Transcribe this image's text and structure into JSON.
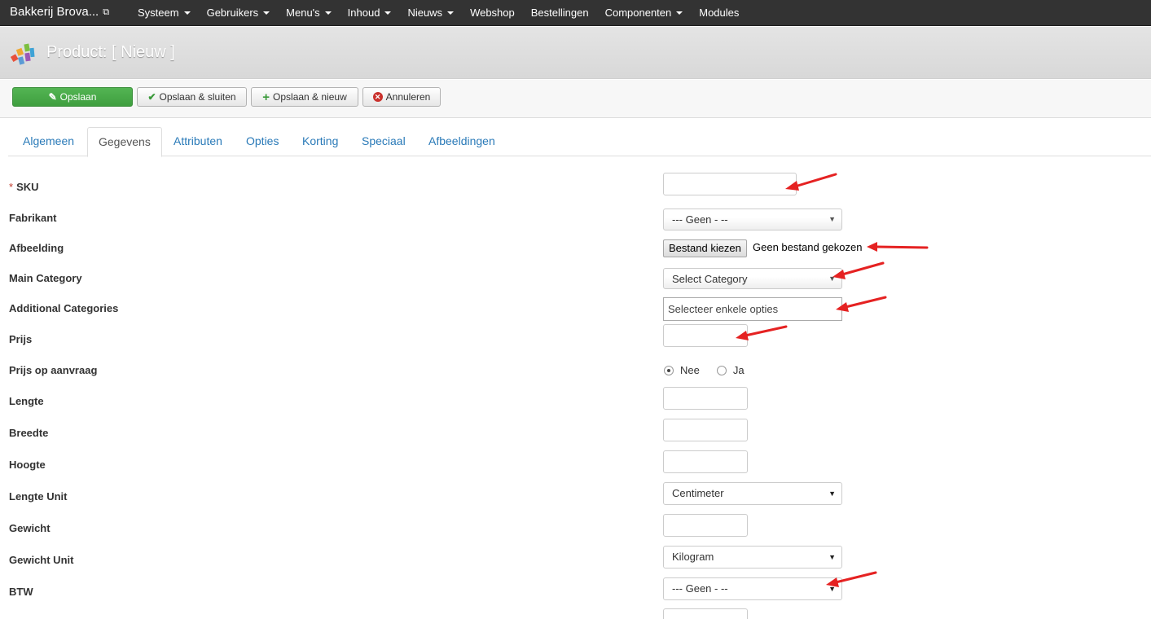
{
  "nav": {
    "brand": "Bakkerij Brova...",
    "items": [
      {
        "label": "Systeem",
        "dropdown": true
      },
      {
        "label": "Gebruikers",
        "dropdown": true
      },
      {
        "label": "Menu's",
        "dropdown": true
      },
      {
        "label": "Inhoud",
        "dropdown": true
      },
      {
        "label": "Nieuws",
        "dropdown": true
      },
      {
        "label": "Webshop",
        "dropdown": false
      },
      {
        "label": "Bestellingen",
        "dropdown": false
      },
      {
        "label": "Componenten",
        "dropdown": true
      },
      {
        "label": "Modules",
        "dropdown": false
      }
    ]
  },
  "header": {
    "title": "Product: [ Nieuw ]"
  },
  "toolbar": {
    "save": "Opslaan",
    "save_close": "Opslaan & sluiten",
    "save_new": "Opslaan & nieuw",
    "cancel": "Annuleren"
  },
  "tabs": {
    "items": [
      "Algemeen",
      "Gegevens",
      "Attributen",
      "Opties",
      "Korting",
      "Speciaal",
      "Afbeeldingen"
    ],
    "active": "Gegevens"
  },
  "form": {
    "required_mark": "*",
    "sku": {
      "label": "SKU",
      "value": ""
    },
    "fabrikant": {
      "label": "Fabrikant",
      "selected": "--- Geen - --"
    },
    "afbeelding": {
      "label": "Afbeelding",
      "button": "Bestand kiezen",
      "status": "Geen bestand gekozen"
    },
    "main_category": {
      "label": "Main Category",
      "selected": "Select Category"
    },
    "additional_categories": {
      "label": "Additional Categories",
      "placeholder": "Selecteer enkele opties"
    },
    "prijs": {
      "label": "Prijs",
      "value": ""
    },
    "prijs_op_aanvraag": {
      "label": "Prijs op aanvraag",
      "options": [
        "Nee",
        "Ja"
      ],
      "selected": "Nee"
    },
    "lengte": {
      "label": "Lengte",
      "value": ""
    },
    "breedte": {
      "label": "Breedte",
      "value": ""
    },
    "hoogte": {
      "label": "Hoogte",
      "value": ""
    },
    "lengte_unit": {
      "label": "Lengte Unit",
      "selected": "Centimeter"
    },
    "gewicht": {
      "label": "Gewicht",
      "value": ""
    },
    "gewicht_unit": {
      "label": "Gewicht Unit",
      "selected": "Kilogram"
    },
    "btw": {
      "label": "BTW",
      "selected": "--- Geen - --"
    }
  },
  "colors": {
    "navbar": "#333333",
    "link": "#2a7ab8",
    "save_button": "#46a546",
    "annotation_arrow": "#e52222"
  }
}
